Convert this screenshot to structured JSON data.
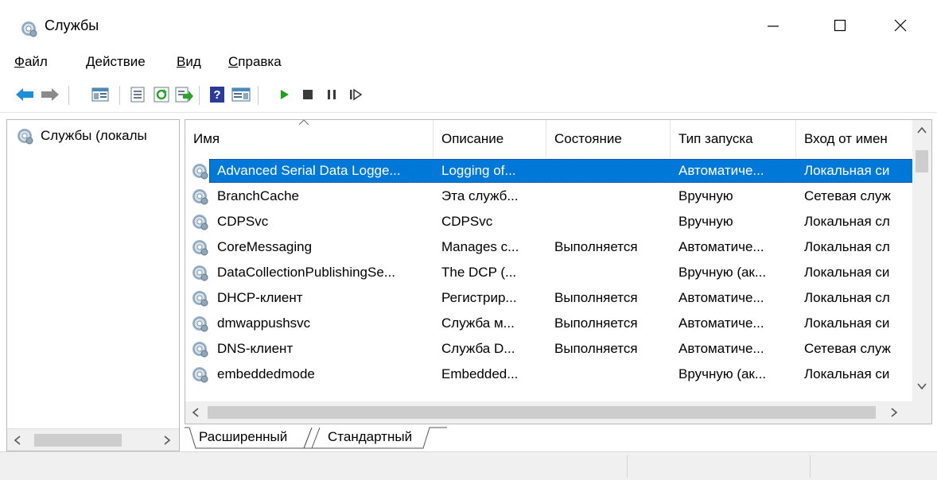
{
  "window": {
    "title": "Службы",
    "icon": "services-gear-icon",
    "controls": [
      "minimize",
      "maximize",
      "close"
    ]
  },
  "menu": {
    "items": [
      {
        "accel": "Ф",
        "rest": "айл"
      },
      {
        "accel": "Д",
        "rest": "ействие"
      },
      {
        "accel": "В",
        "rest": "ид"
      },
      {
        "accel": "С",
        "rest": "правка"
      }
    ]
  },
  "toolbar": {
    "icons": [
      "back-arrow-icon",
      "forward-arrow-icon",
      "show-hide-console-tree-icon",
      "properties-icon",
      "refresh-icon",
      "export-list-icon",
      "help-icon",
      "show-hide-action-pane-icon",
      "start-service-icon",
      "stop-service-icon",
      "pause-service-icon",
      "resume-service-icon"
    ]
  },
  "tree": {
    "label": "Службы (локалы"
  },
  "table": {
    "columns": [
      "Имя",
      "Описание",
      "Состояние",
      "Тип запуска",
      "Вход от имен"
    ],
    "rows": [
      {
        "name": "Advanced Serial Data Logge...",
        "desc": "Logging of...",
        "status": "",
        "startup": "Автоматиче...",
        "logon": "Локальная си"
      },
      {
        "name": "BranchCache",
        "desc": "Эта служб...",
        "status": "",
        "startup": "Вручную",
        "logon": "Сетевая служ"
      },
      {
        "name": "CDPSvc",
        "desc": "CDPSvc",
        "status": "",
        "startup": "Вручную",
        "logon": "Локальная сл"
      },
      {
        "name": "CoreMessaging",
        "desc": "Manages c...",
        "status": "Выполняется",
        "startup": "Автоматиче...",
        "logon": "Локальная сл"
      },
      {
        "name": "DataCollectionPublishingSe...",
        "desc": "The DCP (...",
        "status": "",
        "startup": "Вручную (ак...",
        "logon": "Локальная си"
      },
      {
        "name": "DHCP-клиент",
        "desc": "Регистрир...",
        "status": "Выполняется",
        "startup": "Автоматиче...",
        "logon": "Локальная сл"
      },
      {
        "name": "dmwappushsvc",
        "desc": "Служба м...",
        "status": "Выполняется",
        "startup": "Автоматиче...",
        "logon": "Локальная си"
      },
      {
        "name": "DNS-клиент",
        "desc": "Служба D...",
        "status": "Выполняется",
        "startup": "Автоматиче...",
        "logon": "Сетевая служ"
      },
      {
        "name": "embeddedmode",
        "desc": "Embedded...",
        "status": "",
        "startup": "Вручную (ак...",
        "logon": "Локальная си"
      }
    ],
    "selected_row": 0
  },
  "tabs": {
    "extended": "Расширенный",
    "standard": "Стандартный"
  },
  "colors": {
    "selection": "#0078d7",
    "play": "#1aa31a"
  }
}
